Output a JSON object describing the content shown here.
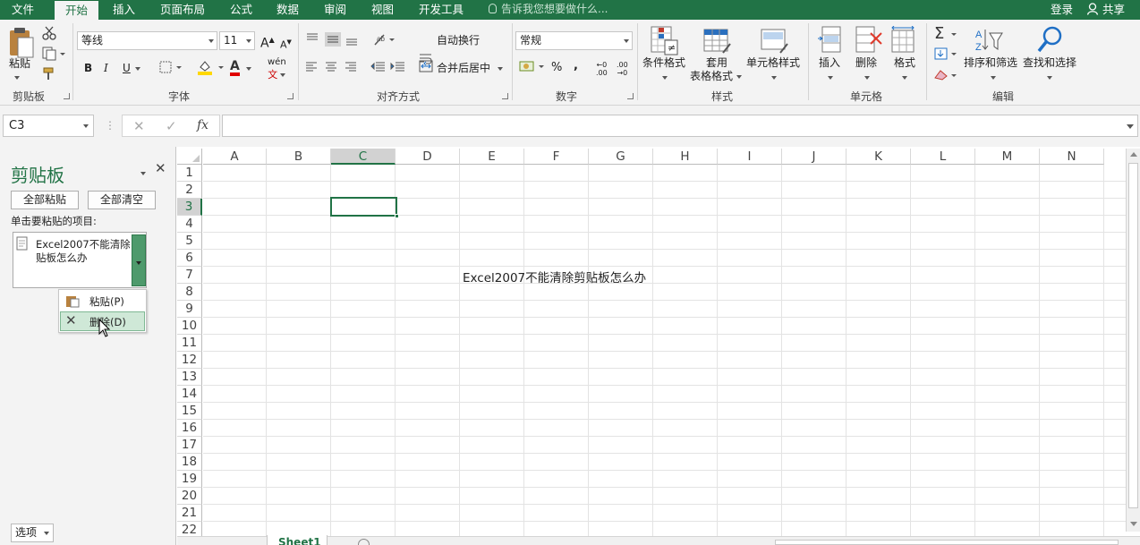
{
  "tabs": [
    "文件",
    "开始",
    "插入",
    "页面布局",
    "公式",
    "数据",
    "审阅",
    "视图",
    "开发工具"
  ],
  "tellme": "告诉我您想要做什么...",
  "account": {
    "login": "登录",
    "share": "共享"
  },
  "ribbon": {
    "clipboard": {
      "paste": "粘贴",
      "group": "剪贴板"
    },
    "font": {
      "name": "等线",
      "size": "11",
      "bold": "B",
      "italic": "I",
      "underline": "U",
      "grow": "A",
      "shrink": "A",
      "color_a": "A",
      "wen": "wén",
      "group": "字体"
    },
    "alignment": {
      "wrap": "自动换行",
      "merge": "合并后居中",
      "group": "对齐方式"
    },
    "number": {
      "format": "常规",
      "percent": "%",
      "comma": ",",
      "inc": ".00",
      "dec": ".00",
      "group": "数字"
    },
    "styles": {
      "cond": "条件格式",
      "table1": "套用",
      "table2": "表格格式",
      "cell": "单元格样式",
      "group": "样式"
    },
    "cells": {
      "insert": "插入",
      "delete": "删除",
      "format": "格式",
      "group": "单元格"
    },
    "editing": {
      "sort": "排序和筛选",
      "find": "查找和选择",
      "group": "编辑"
    }
  },
  "formula": {
    "namebox": "C3",
    "fx": "fx",
    "value": ""
  },
  "clipboard_pane": {
    "title": "剪贴板",
    "paste_all": "全部粘贴",
    "clear_all": "全部清空",
    "instruction": "单击要粘贴的项目:",
    "item_line1": "Excel2007不能清除",
    "item_line2": "贴板怎么办",
    "menu_paste": "粘贴(P)",
    "menu_delete": "删除(D)",
    "options": "选项"
  },
  "sheet": {
    "columns": [
      "A",
      "B",
      "C",
      "D",
      "E",
      "F",
      "G",
      "H",
      "I",
      "J",
      "K",
      "L",
      "M",
      "N"
    ],
    "rows": [
      "1",
      "2",
      "3",
      "4",
      "5",
      "6",
      "7",
      "8",
      "9",
      "10",
      "11",
      "12",
      "13",
      "14",
      "15",
      "16",
      "17",
      "18",
      "19",
      "20",
      "21",
      "22"
    ],
    "selected_col": "C",
    "selected_row": "3",
    "cell_text": "Excel2007不能清除剪贴板怎么办",
    "sheet_tab": "Sheet1"
  },
  "colors": {
    "accent": "#217346",
    "selection": "#217346"
  }
}
